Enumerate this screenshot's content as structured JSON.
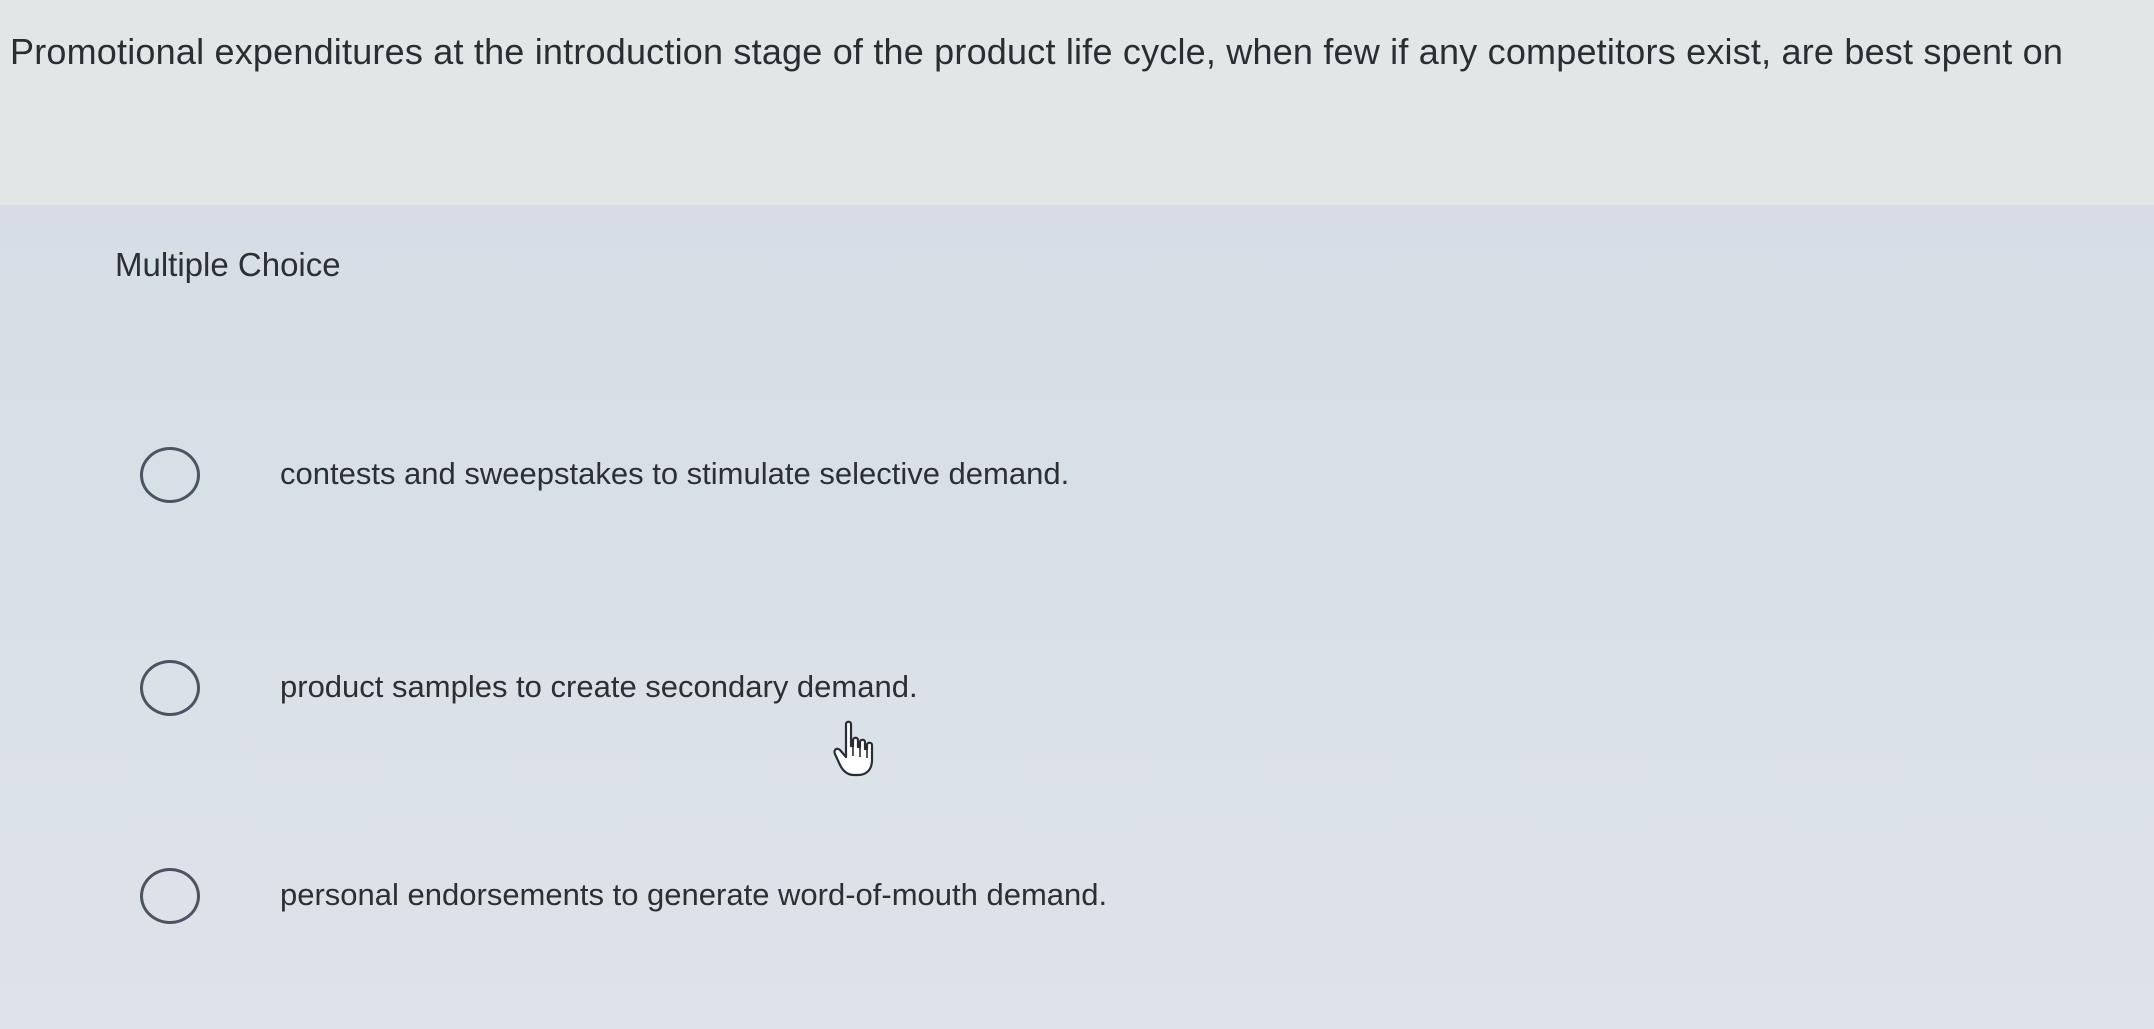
{
  "question": {
    "text": "Promotional expenditures at the introduction stage of the product life cycle, when few if any competitors exist, are best spent on"
  },
  "section": {
    "label": "Multiple Choice"
  },
  "choices": [
    {
      "label": "contests and sweepstakes to stimulate selective demand.",
      "selected": false
    },
    {
      "label": "product samples to create secondary demand.",
      "selected": false
    },
    {
      "label": "personal endorsements to generate word-of-mouth demand.",
      "selected": false
    }
  ],
  "icons": {
    "radio": "radio-button-empty",
    "cursor": "hand-pointer-icon"
  }
}
